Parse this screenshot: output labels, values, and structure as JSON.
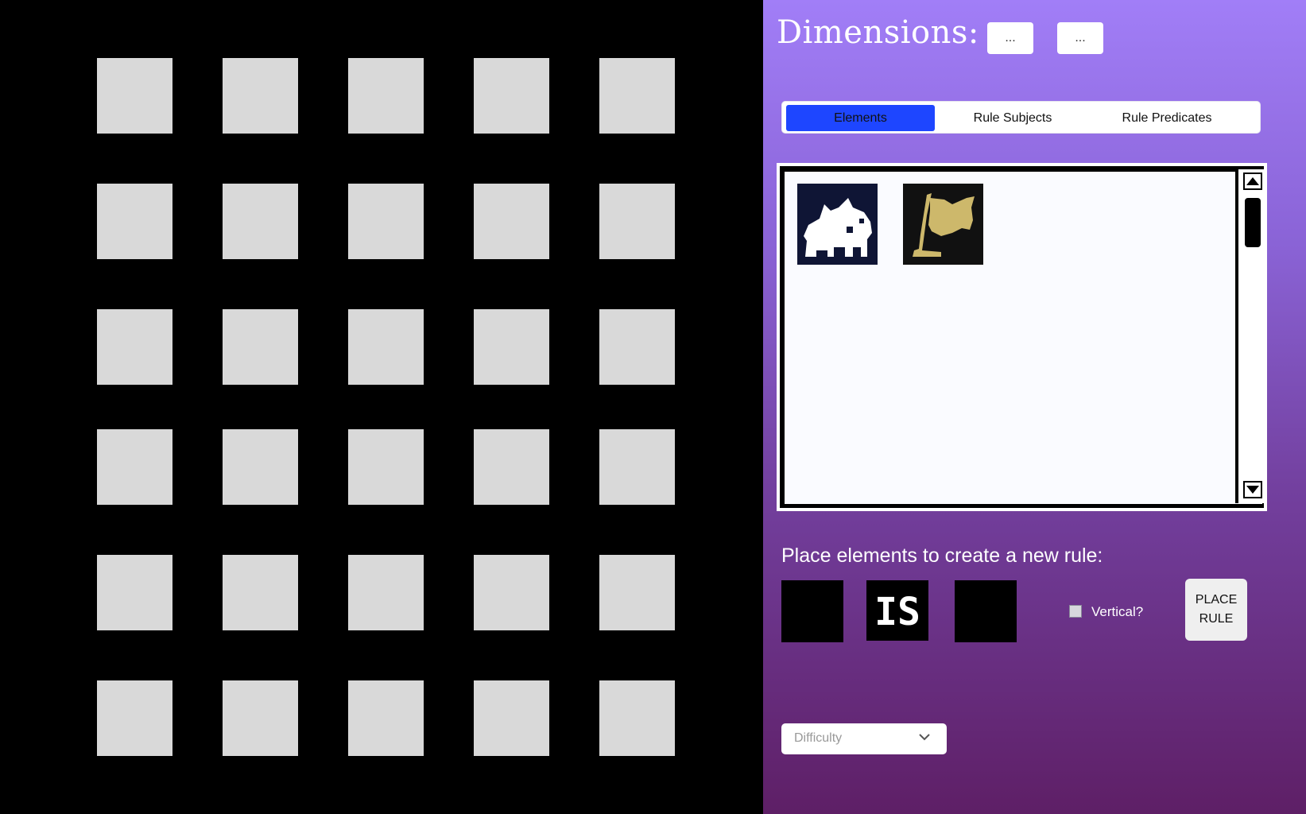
{
  "board": {
    "rows": 6,
    "cols": 5,
    "cell_color": "#d9d9d9",
    "background": "#000000"
  },
  "panel": {
    "dimensions_label": "Dimensions:",
    "dim_width_button": "...",
    "dim_height_button": "...",
    "tabs": [
      {
        "label": "Elements",
        "active": true
      },
      {
        "label": "Rule Subjects",
        "active": false
      },
      {
        "label": "Rule Predicates",
        "active": false
      }
    ],
    "palette": {
      "items": [
        {
          "icon": "baba-icon",
          "colors": {
            "bg": "#0f1535",
            "fg": "#ffffff"
          }
        },
        {
          "icon": "flag-icon",
          "colors": {
            "bg": "#111111",
            "fg": "#cdb86b"
          }
        }
      ]
    },
    "rule_heading": "Place elements to create a new rule:",
    "rule_operator": "IS",
    "vertical_label": "Vertical?",
    "vertical_checked": false,
    "place_rule_button": "PLACE RULE",
    "difficulty_placeholder": "Difficulty",
    "accent_color": "#1e46ff"
  }
}
